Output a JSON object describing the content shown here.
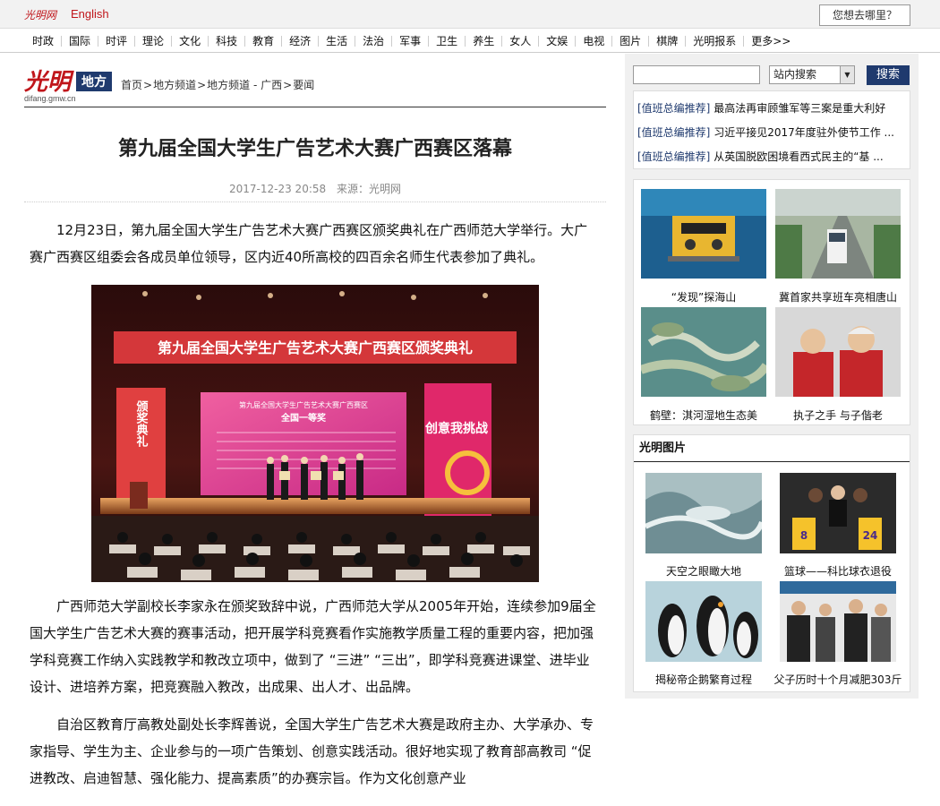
{
  "topbar": {
    "logo_text": "光明网",
    "english_label": "English",
    "where_button": "您想去哪里？"
  },
  "nav": {
    "items": [
      "时政",
      "国际",
      "时评",
      "理论",
      "文化",
      "科技",
      "教育",
      "经济",
      "生活",
      "法治",
      "军事",
      "卫生",
      "养生",
      "女人",
      "文娱",
      "电视",
      "图片",
      "棋牌",
      "光明报系",
      "更多>>"
    ]
  },
  "channel": {
    "logo_name": "光明",
    "logo_badge": "地方",
    "logo_url": "difang.gmw.cn",
    "breadcrumb": [
      "首页",
      "地方频道",
      "地方频道 - 广西",
      "要闻"
    ]
  },
  "article": {
    "title": "第九届全国大学生广告艺术大赛广西赛区落幕",
    "date": "2017-12-23 20:58",
    "source": "来源：光明网",
    "para1": "12月23日，第九届全国大学生广告艺术大赛广西赛区颁奖典礼在广西师范大学举行。大广赛广西赛区组委会各成员单位领导，区内近40所高校的四百余名师生代表参加了典礼。",
    "photo_banner": "第九届全国大学生广告艺术大赛广西赛区颁奖典礼",
    "photo_screen_title": "第九届全国大学生广告艺术大赛广西赛区",
    "photo_screen_sub": "全国一等奖",
    "photo_side_left": "颁奖典礼",
    "photo_side_right": "创意我挑战",
    "para2": "广西师范大学副校长李家永在颁奖致辞中说，广西师范大学从2005年开始，连续参加9届全国大学生广告艺术大赛的赛事活动，把开展学科竞赛看作实施教学质量工程的重要内容，把加强学科竞赛工作纳入实践教学和教改立项中，做到了 “三进” “三出”，即学科竞赛进课堂、进毕业设计、进培养方案，把竞赛融入教改，出成果、出人才、出品牌。",
    "para3": "自治区教育厅高教处副处长李辉善说，全国大学生广告艺术大赛是政府主办、大学承办、专家指导、学生为主、企业参与的一项广告策划、创意实践活动。很好地实现了教育部高教司 “促进教改、启迪智慧、强化能力、提高素质”的办赛宗旨。作为文化创意产业"
  },
  "sidebar": {
    "search_placeholder": "",
    "search_scope": "站内搜索",
    "search_button": "搜索",
    "recommend_tag": "[值班总编推荐]",
    "recommend": [
      "最高法再审顾雏军等三案是重大利好",
      "习近平接见2017年度驻外使节工作 ...",
      "从英国脱欧困境看西式民主的“基 ..."
    ],
    "pics": [
      {
        "caption": "“发现”探海山"
      },
      {
        "caption": "冀首家共享班车亮相唐山"
      },
      {
        "caption": "鹤壁：淇河湿地生态美"
      },
      {
        "caption": "执子之手 与子偕老"
      }
    ],
    "gm_title": "光明图片",
    "gm_pics": [
      {
        "caption": "天空之眼瞰大地"
      },
      {
        "caption": "篮球——科比球衣退役"
      },
      {
        "caption": "揭秘帝企鹅繁育过程"
      },
      {
        "caption": "父子历时十个月减肥303斤"
      }
    ],
    "jersey_numbers": [
      "8",
      "24"
    ]
  },
  "colors": {
    "brand_red": "#c0161b",
    "brand_blue": "#1f3a6e",
    "event_magenta": "#e8337a"
  }
}
